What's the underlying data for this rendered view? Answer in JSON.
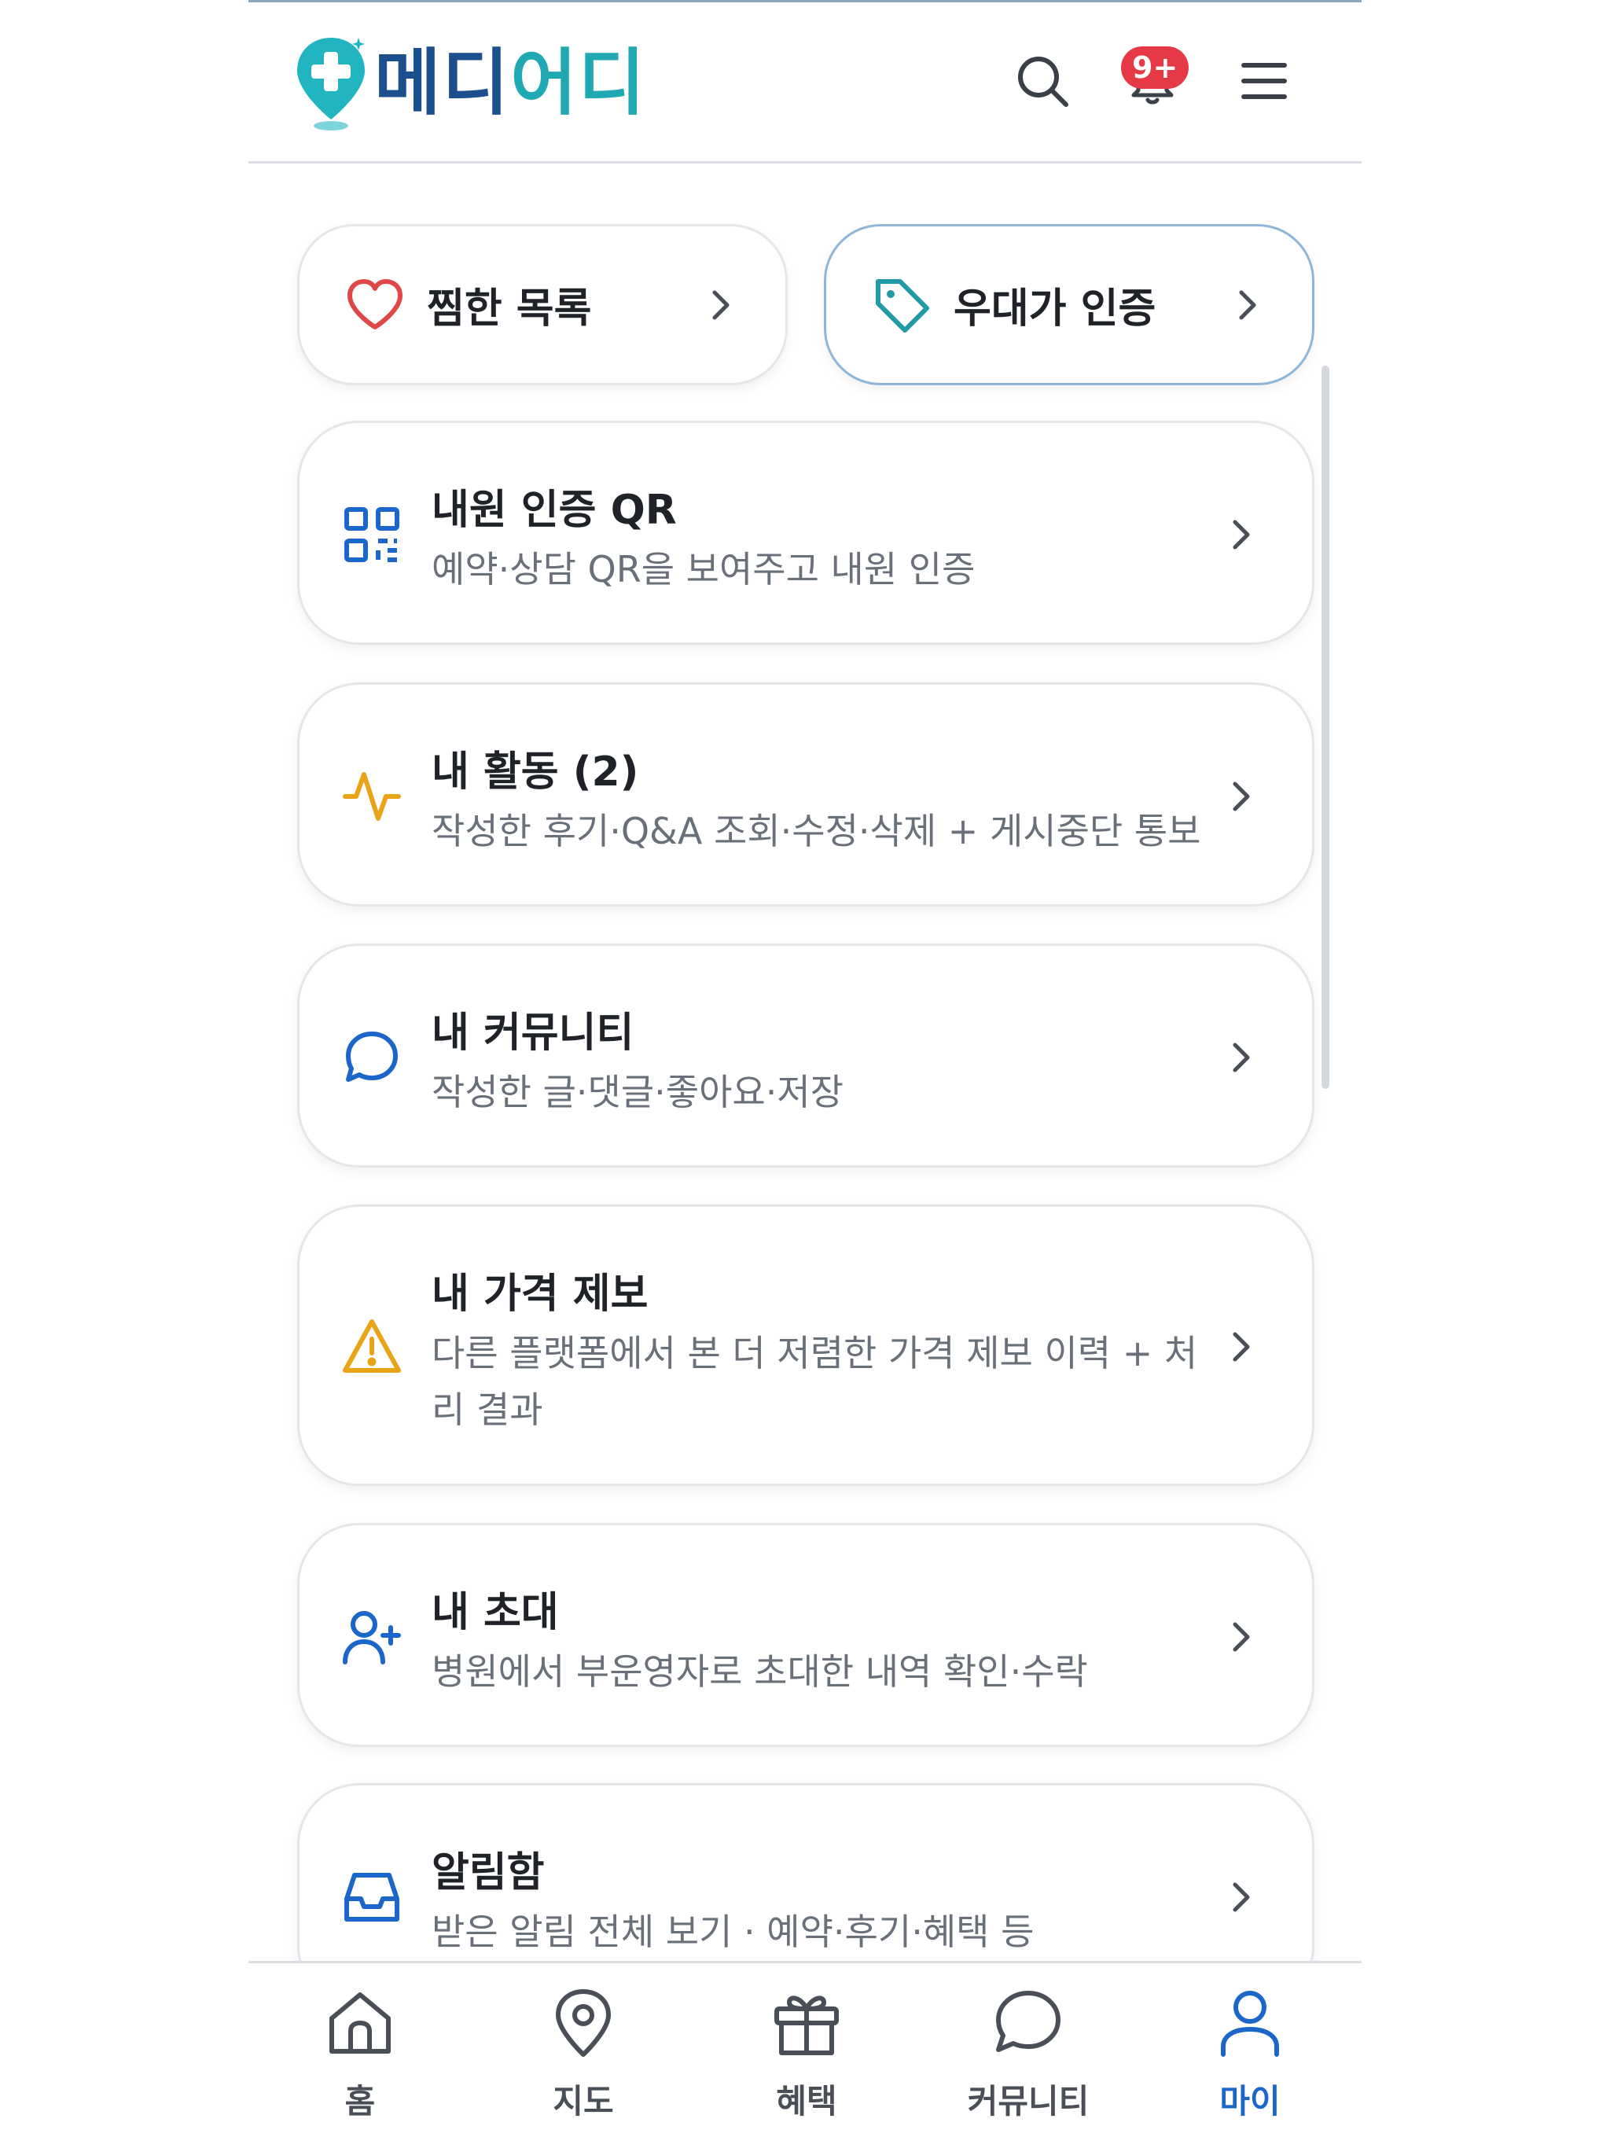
{
  "header": {
    "logo_part1": "메디",
    "logo_part2": "어디",
    "notification_badge": "9+"
  },
  "quick_actions": [
    {
      "label": "찜한 목록",
      "icon": "heart-icon"
    },
    {
      "label": "우대가 인증",
      "icon": "tag-icon"
    }
  ],
  "menu": [
    {
      "title": "내원 인증 QR",
      "desc": "예약·상담 QR을 보여주고 내원 인증",
      "icon": "qr-icon"
    },
    {
      "title": "내 활동 (2)",
      "desc": "작성한 후기·Q&A 조회·수정·삭제 + 게시중단 통보",
      "icon": "activity-icon"
    },
    {
      "title": "내 커뮤니티",
      "desc": "작성한 글·댓글·좋아요·저장",
      "icon": "chat-icon"
    },
    {
      "title": "내 가격 제보",
      "desc": "다른 플랫폼에서 본 더 저렴한 가격 제보 이력 + 처리 결과",
      "icon": "warning-icon"
    },
    {
      "title": "내 초대",
      "desc": "병원에서 부운영자로 초대한 내역 확인·수락",
      "icon": "user-plus-icon"
    },
    {
      "title": "알림함",
      "desc": "받은 알림 전체 보기 · 예약·후기·혜택 등",
      "icon": "inbox-icon"
    }
  ],
  "bottom_nav": [
    {
      "label": "홈",
      "icon": "home-icon"
    },
    {
      "label": "지도",
      "icon": "map-pin-icon"
    },
    {
      "label": "혜택",
      "icon": "gift-icon"
    },
    {
      "label": "커뮤니티",
      "icon": "chat-icon"
    },
    {
      "label": "마이",
      "icon": "user-icon"
    }
  ],
  "colors": {
    "brand_navy": "#1b4f8e",
    "brand_teal": "#21a9b3",
    "active_blue": "#1b66c9",
    "badge_red": "#e63946",
    "heart_red": "#e04848",
    "activity_amber": "#e8a317"
  }
}
